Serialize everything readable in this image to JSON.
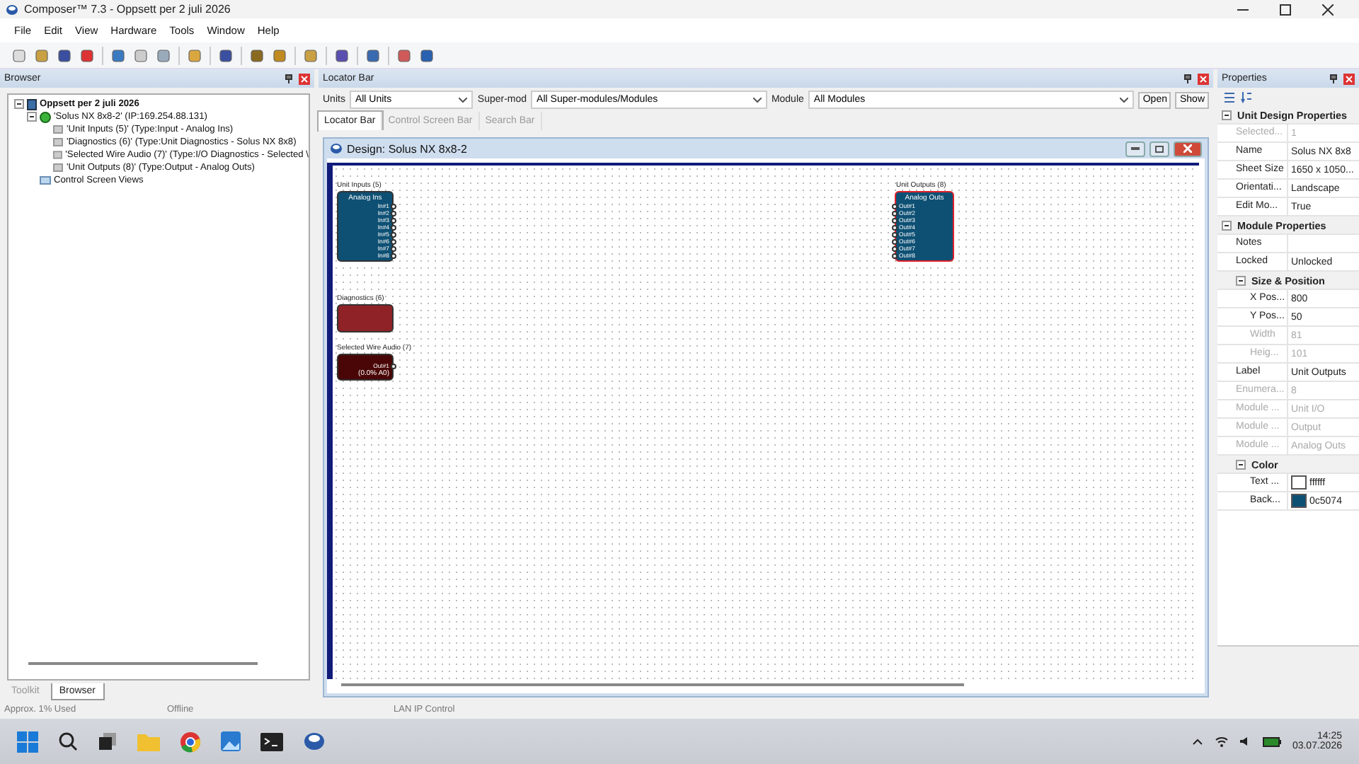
{
  "window": {
    "title": "Composer™ 7.3 - Oppsett per 2 juli 2026"
  },
  "menu": [
    "File",
    "Edit",
    "View",
    "Hardware",
    "Tools",
    "Window",
    "Help"
  ],
  "browser": {
    "title": "Browser",
    "tree": [
      {
        "label": "Oppsett per 2 juli 2026",
        "kind": "project",
        "expanded": true,
        "children": [
          {
            "label": "'Solus NX 8x8-2' (IP:169.254.88.131)",
            "kind": "unit",
            "expanded": true,
            "children": [
              {
                "label": "'Unit Inputs (5)' (Type:Input - Analog Ins)",
                "kind": "module"
              },
              {
                "label": "'Diagnostics (6)' (Type:Unit Diagnostics - Solus NX 8x8)",
                "kind": "module"
              },
              {
                "label": "'Selected Wire Audio (7)' (Type:I/O Diagnostics - Selected \\",
                "kind": "module"
              },
              {
                "label": "'Unit Outputs (8)' (Type:Output - Analog Outs)",
                "kind": "module"
              }
            ]
          },
          {
            "label": "Control Screen Views",
            "kind": "views"
          }
        ]
      }
    ],
    "tabs": [
      {
        "label": "Toolkit",
        "selected": false
      },
      {
        "label": "Browser",
        "selected": true
      }
    ]
  },
  "locator": {
    "title": "Locator Bar",
    "filters": [
      {
        "label": "Units",
        "value": "All Units"
      },
      {
        "label": "Super-mod",
        "value": "All Super-modules/Modules"
      },
      {
        "label": "Module",
        "value": "All Modules"
      }
    ],
    "buttons": [
      "Open",
      "Show"
    ],
    "tabs": [
      {
        "label": "Locator Bar",
        "selected": true
      },
      {
        "label": "Control Screen Bar",
        "selected": false
      },
      {
        "label": "Search Bar",
        "selected": false
      }
    ]
  },
  "design": {
    "title": "Design: Solus NX 8x8-2",
    "modules": [
      {
        "caption": "Unit Inputs (5)",
        "kind": "input",
        "header": "Analog Ins",
        "ports": [
          "In#1",
          "In#2",
          "In#3",
          "In#4",
          "In#5",
          "In#6",
          "In#7",
          "In#8"
        ],
        "selected": false
      },
      {
        "caption": "Unit Outputs (8)",
        "kind": "output",
        "header": "Analog Outs",
        "ports": [
          "Out#1",
          "Out#2",
          "Out#3",
          "Out#4",
          "Out#5",
          "Out#6",
          "Out#7",
          "Out#8"
        ],
        "selected": true
      },
      {
        "caption": "Diagnostics (6)",
        "kind": "diagnostics",
        "selected": false
      },
      {
        "caption": "Selected Wire Audio (7)",
        "kind": "wire",
        "ports": [
          "Out#1"
        ],
        "reading": "(0.0% A0)",
        "selected": false
      }
    ]
  },
  "properties": {
    "title": "Properties",
    "groups": [
      {
        "title": "Unit Design Properties",
        "expanded": true,
        "rows": [
          {
            "name": "Selected...",
            "value": "1",
            "disabled": true
          },
          {
            "name": "Name",
            "value": "Solus NX 8x8",
            "disabled": false
          },
          {
            "name": "Sheet Size",
            "value": "1650 x 1050...",
            "disabled": false
          },
          {
            "name": "Orientati...",
            "value": "Landscape",
            "disabled": false
          },
          {
            "name": "Edit Mo...",
            "value": "True",
            "disabled": false
          }
        ]
      },
      {
        "title": "Module Properties",
        "expanded": true,
        "rows": [
          {
            "name": "Notes",
            "value": "",
            "disabled": false
          },
          {
            "name": "Locked",
            "value": "Unlocked",
            "disabled": false
          }
        ],
        "subgroups": [
          {
            "title": "Size & Position",
            "expanded": true,
            "rows": [
              {
                "name": "X Pos...",
                "value": "800",
                "disabled": false
              },
              {
                "name": "Y Pos...",
                "value": "50",
                "disabled": false
              },
              {
                "name": "Width",
                "value": "81",
                "disabled": true
              },
              {
                "name": "Heig...",
                "value": "101",
                "disabled": true
              }
            ]
          }
        ],
        "rows_after": [
          {
            "name": "Label",
            "value": "Unit Outputs",
            "disabled": false
          },
          {
            "name": "Enumera...",
            "value": "8",
            "disabled": true
          },
          {
            "name": "Module ...",
            "value": "Unit I/O",
            "disabled": true
          },
          {
            "name": "Module ...",
            "value": "Output",
            "disabled": true
          },
          {
            "name": "Module ...",
            "value": "Analog Outs",
            "disabled": true
          }
        ],
        "subgroups_after": [
          {
            "title": "Color",
            "expanded": true,
            "rows": [
              {
                "name": "Text ...",
                "value": "ffffff",
                "color": "#ffffff",
                "disabled": false
              },
              {
                "name": "Back...",
                "value": "0c5074",
                "color": "#0c5074",
                "disabled": false
              }
            ]
          }
        ]
      }
    ]
  },
  "status_bar": [
    "Approx. 1% Used",
    "Offline",
    "LAN IP Control"
  ],
  "taskbar": {
    "time": "14:25",
    "date": "03.07.2026"
  }
}
